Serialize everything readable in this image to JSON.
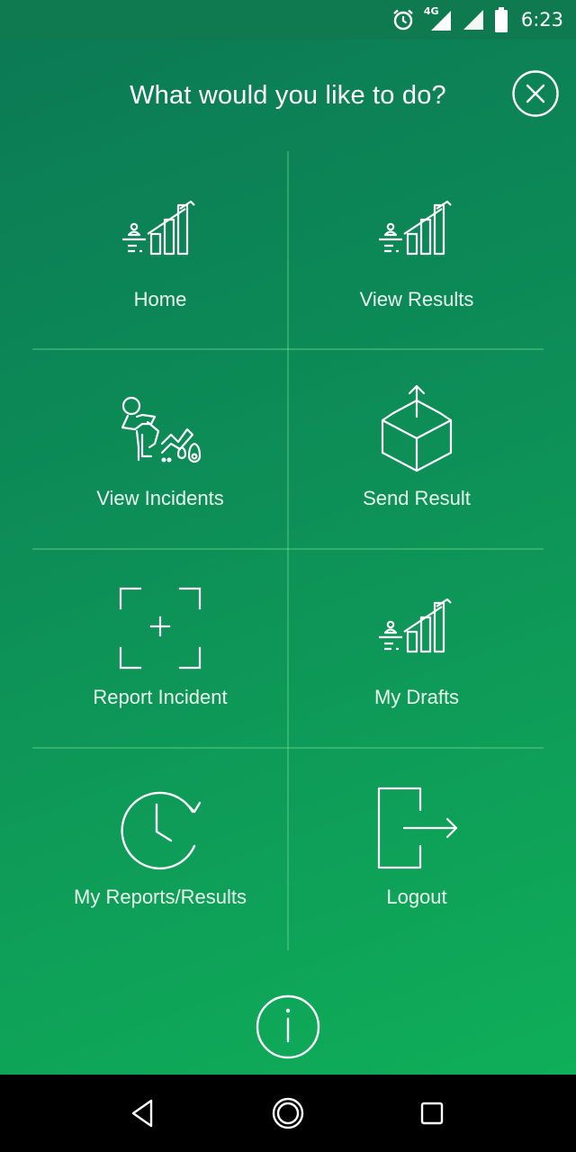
{
  "status_bar": {
    "time": "6:23",
    "network": "4G",
    "icons": [
      "alarm-icon",
      "signal-icon",
      "signal-icon",
      "battery-icon"
    ]
  },
  "menu": {
    "title": "What would you like to do?",
    "close_icon": "close-circle-icon",
    "items": [
      {
        "label": "Home",
        "icon": "chart-growth-icon"
      },
      {
        "label": "View Results",
        "icon": "chart-growth-icon"
      },
      {
        "label": "View Incidents",
        "icon": "worker-incident-icon"
      },
      {
        "label": "Send Result",
        "icon": "box-upload-icon"
      },
      {
        "label": "Report Incident",
        "icon": "scan-plus-icon"
      },
      {
        "label": "My Drafts",
        "icon": "chart-growth-icon"
      },
      {
        "label": "My Reports/Results",
        "icon": "clock-history-icon"
      },
      {
        "label": "Logout",
        "icon": "logout-icon"
      }
    ],
    "info_icon": "info-icon"
  },
  "nav_bar": {
    "icons": [
      "back-icon",
      "home-icon",
      "recents-icon"
    ]
  },
  "colors": {
    "gradient_start": "#0b7a55",
    "gradient_end": "#0fae59",
    "status_bar": "#0f7a50",
    "divider": "#78e696",
    "text": "#ffffff"
  }
}
